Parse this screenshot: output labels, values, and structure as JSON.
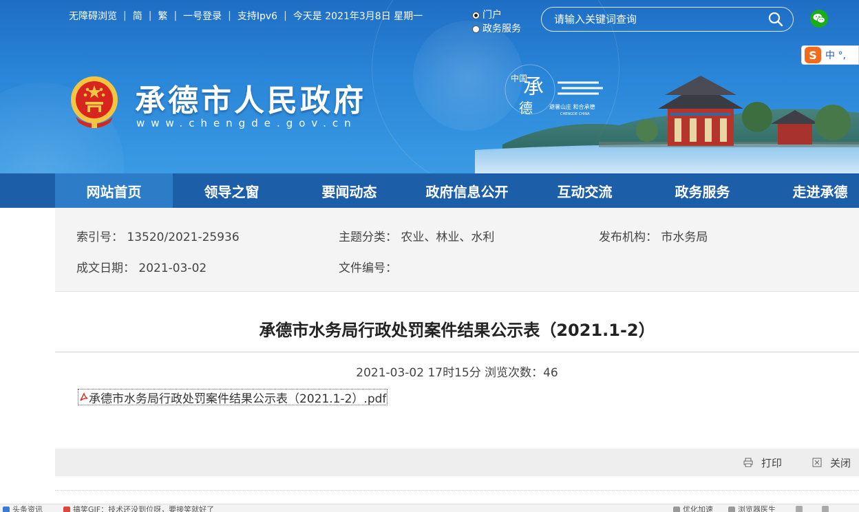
{
  "colors": {
    "header_blue": "#2a86d8",
    "nav_blue": "#1d5ea8",
    "nav_active": "#2c7cc8",
    "wechat_green": "#1aad19",
    "emblem_red": "#d7261e",
    "emblem_gold": "#f5c542"
  },
  "topbar": {
    "accessibility": "无障碍浏览",
    "simplified": "简",
    "traditional": "繁",
    "login": "一号登录",
    "ipv6": "支持Ipv6",
    "date": "今天是 2021年3月8日  星期一"
  },
  "search_scope": {
    "options": [
      "门户",
      "政务服务"
    ],
    "selected": "门户"
  },
  "search": {
    "placeholder": "请输入关键词查询",
    "icon": "search-icon"
  },
  "wechat": {
    "icon": "wechat-icon"
  },
  "ime": {
    "logo": "S",
    "text": "中 °,"
  },
  "site": {
    "title": "承德市人民政府",
    "url": "www.chengde.gov.cn"
  },
  "banner_logo": {
    "big": "承",
    "small_left": "中国",
    "small_bottom": "德",
    "slogan": "避暑山庄  和合承德",
    "en": "CHENGDE CHINA"
  },
  "nav": {
    "items": [
      "网站首页",
      "领导之窗",
      "要闻动态",
      "政府信息公开",
      "互动交流",
      "政务服务",
      "走进承德"
    ],
    "active": "网站首页"
  },
  "meta": {
    "index_no": "索引号：  13520/2021-25936",
    "topic": "主题分类：  农业、林业、水利",
    "publisher": "发布机构：  市水务局",
    "date": "成文日期：  2021-03-02",
    "doc_no": "文件编号："
  },
  "article": {
    "title": "承德市水务局行政处罚案件结果公示表（2021.1-2）",
    "info": "2021-03-02  17时15分   浏览次数：46",
    "attachment": "承德市水务局行政处罚案件结果公示表（2021.1-2）.pdf"
  },
  "tools": {
    "print": "打印",
    "close": "关闭"
  },
  "statusbar": {
    "left1": "头条资讯",
    "left2": "搞笑GIF：技术还没到位呀，要接笑就好了",
    "right1": "优化加速",
    "right2": "浏览器医生"
  }
}
